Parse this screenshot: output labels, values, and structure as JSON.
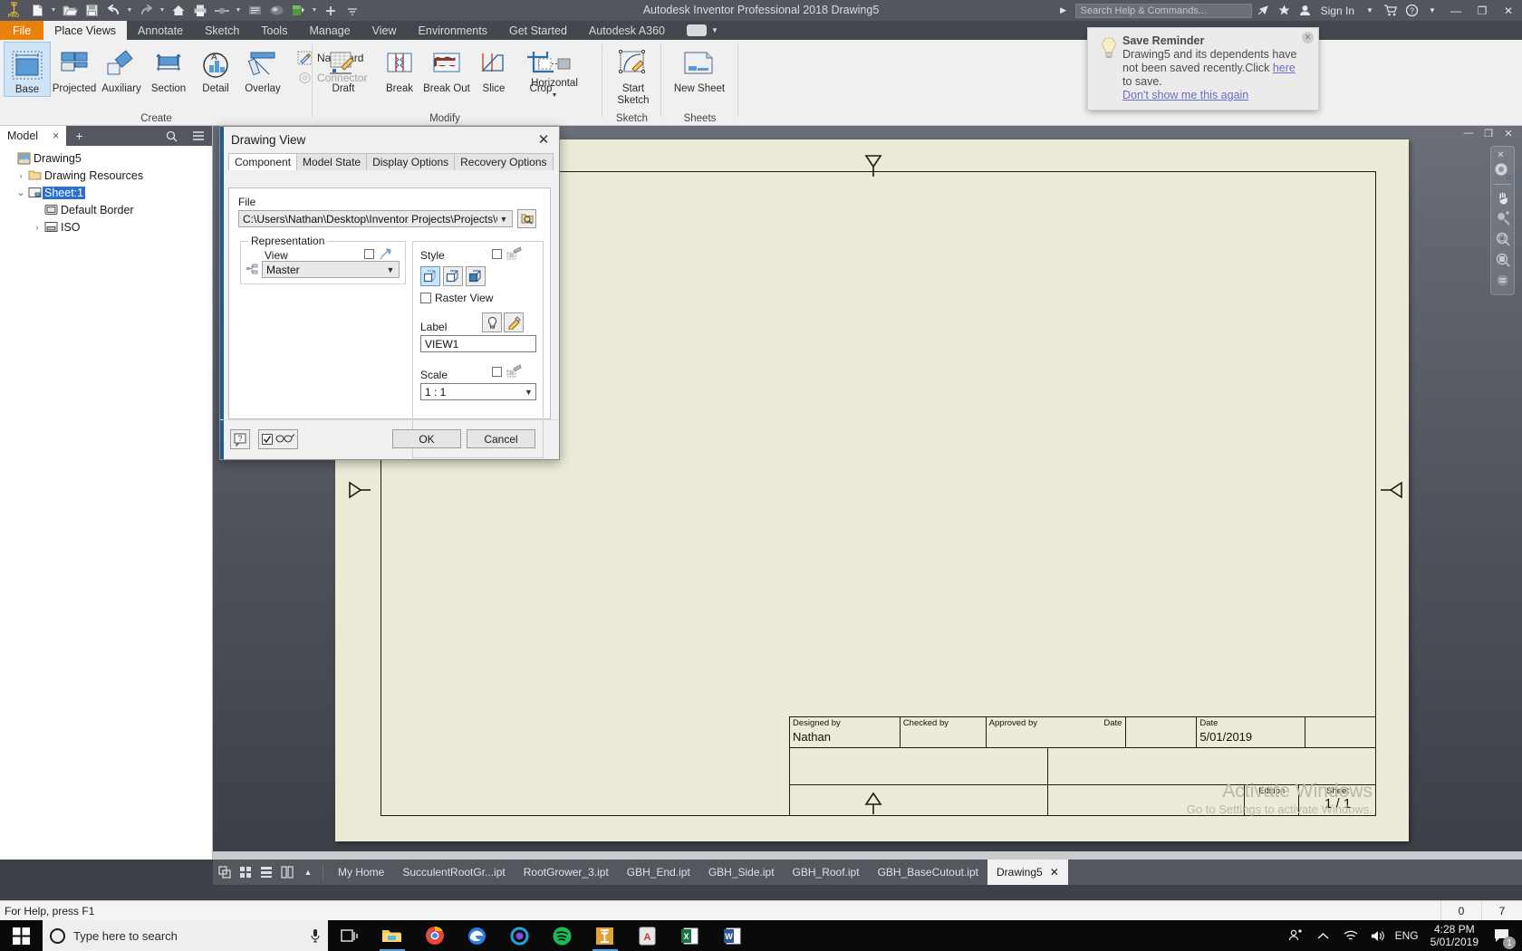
{
  "titlebar": {
    "app_title": "Autodesk Inventor Professional 2018   Drawing5",
    "search_placeholder": "Search Help & Commands...",
    "signin": "Sign In",
    "qat_icons": [
      "inventor-pro-logo",
      "new-icon",
      "open-icon",
      "save-icon",
      "undo-icon",
      "redo-icon",
      "home-icon",
      "print-icon",
      "select-icon",
      "parameters-icon",
      "materials-icon",
      "appearance-icon",
      "add-icon",
      "qat-dropdown-icon"
    ],
    "window_buttons": [
      "minimize",
      "restore",
      "close"
    ]
  },
  "ribbon": {
    "tabs": [
      {
        "label": "File",
        "kind": "file"
      },
      {
        "label": "Place Views",
        "kind": "active"
      },
      {
        "label": "Annotate",
        "kind": "normal"
      },
      {
        "label": "Sketch",
        "kind": "normal"
      },
      {
        "label": "Tools",
        "kind": "normal"
      },
      {
        "label": "Manage",
        "kind": "normal"
      },
      {
        "label": "View",
        "kind": "normal"
      },
      {
        "label": "Environments",
        "kind": "normal"
      },
      {
        "label": "Get Started",
        "kind": "normal"
      },
      {
        "label": "Autodesk A360",
        "kind": "normal"
      }
    ],
    "panels": [
      {
        "name": "Create",
        "label": "Create",
        "big_buttons": [
          {
            "label": "Base",
            "selected": true
          },
          {
            "label": "Projected",
            "selected": false
          },
          {
            "label": "Auxiliary",
            "selected": false
          },
          {
            "label": "Section",
            "selected": false
          },
          {
            "label": "Detail",
            "selected": false
          },
          {
            "label": "Overlay",
            "selected": false
          }
        ],
        "small_buttons": [
          {
            "label": "Nailboard",
            "disabled": false
          },
          {
            "label": "Connector",
            "disabled": true
          }
        ]
      },
      {
        "name": "Modify",
        "label": "Modify",
        "big_buttons": [
          {
            "label": "Draft",
            "selected": false
          },
          {
            "label": "Break",
            "selected": false
          },
          {
            "label": "Break Out",
            "selected": false
          },
          {
            "label": "Slice",
            "selected": false
          },
          {
            "label": "Crop",
            "selected": false
          },
          {
            "label": "Horizontal",
            "selected": false
          }
        ]
      },
      {
        "name": "Sketch",
        "label": "Sketch",
        "big_buttons": [
          {
            "label": "Start\nSketch",
            "selected": false
          }
        ]
      },
      {
        "name": "Sheets",
        "label": "Sheets",
        "big_buttons": [
          {
            "label": "New Sheet",
            "selected": false
          }
        ]
      }
    ]
  },
  "reminder": {
    "title": "Save Reminder",
    "line1": "Drawing5 and its dependents have",
    "line2": "not been saved recently.Click",
    "link_here": "here",
    "line3": "to save.",
    "dont_show": "Don't show me this again"
  },
  "browser": {
    "tab_label": "Model",
    "close_label": "×",
    "add_label": "+",
    "tree": [
      {
        "label": "Drawing5",
        "icon": "drawing-icon",
        "depth": 0,
        "expander": "",
        "selected": false
      },
      {
        "label": "Drawing Resources",
        "icon": "folder-icon",
        "depth": 1,
        "expander": "›",
        "selected": false
      },
      {
        "label": "Sheet:1",
        "icon": "sheet-icon",
        "depth": 1,
        "expander": "⌄",
        "selected": true
      },
      {
        "label": "Default Border",
        "icon": "border-icon",
        "depth": 2,
        "expander": "",
        "selected": false
      },
      {
        "label": "ISO",
        "icon": "titleblock-icon",
        "depth": 2,
        "expander": "›",
        "selected": false
      }
    ]
  },
  "dialog": {
    "title": "Drawing View",
    "close_label": "✕",
    "tabs": [
      {
        "label": "Component",
        "active": true
      },
      {
        "label": "Model State",
        "active": false
      },
      {
        "label": "Display Options",
        "active": false
      },
      {
        "label": "Recovery Options",
        "active": false
      }
    ],
    "file_label": "File",
    "file_value": "C:\\Users\\Nathan\\Desktop\\Inventor Projects\\Projects\\GBH\\G",
    "representation_label": "Representation",
    "view_label": "View",
    "view_value": "Master",
    "style_label": "Style",
    "style_buttons": [
      "hidden-line-icon",
      "hidden-line-removed-icon",
      "shaded-icon"
    ],
    "style_selected_index": 0,
    "raster_view_label": "Raster View",
    "raster_view_checked": false,
    "label_label": "Label",
    "label_value": "VIEW1",
    "scale_label": "Scale",
    "scale_value": "1 : 1",
    "ok_label": "OK",
    "cancel_label": "Cancel",
    "help_label": "?",
    "checkbox_checked": true
  },
  "titleblock": {
    "designed_by_caption": "Designed by",
    "designed_by_value": "Nathan",
    "checked_by_caption": "Checked by",
    "approved_by_caption": "Approved by",
    "date_caption_1": "Date",
    "date_caption_2": "Date",
    "date_value": "5/01/2019",
    "edition_caption": "Edition",
    "sheet_caption": "Sheet",
    "sheet_value": "1 / 1"
  },
  "watermark": {
    "line1": "Activate Windows",
    "line2": "Go to Settings to activate Windows."
  },
  "doc_tabs": {
    "view_icons": [
      "tile-icon",
      "grid-icon",
      "list-icon",
      "columns-icon",
      "collapse-icon"
    ],
    "items": [
      {
        "label": "My Home",
        "active": false,
        "closable": false
      },
      {
        "label": "SucculentRootGr...ipt",
        "active": false,
        "closable": false
      },
      {
        "label": "RootGrower_3.ipt",
        "active": false,
        "closable": false
      },
      {
        "label": "GBH_End.ipt",
        "active": false,
        "closable": false
      },
      {
        "label": "GBH_Side.ipt",
        "active": false,
        "closable": false
      },
      {
        "label": "GBH_Roof.ipt",
        "active": false,
        "closable": false
      },
      {
        "label": "GBH_BaseCutout.ipt",
        "active": false,
        "closable": false
      },
      {
        "label": "Drawing5",
        "active": true,
        "closable": true
      }
    ]
  },
  "statusbar": {
    "help_text": "For Help, press F1",
    "cell_1": "0",
    "cell_2": "7"
  },
  "taskbar": {
    "search_placeholder": "Type here to search",
    "icons": [
      "task-view-icon",
      "file-explorer-icon",
      "chrome-icon",
      "edge-icon",
      "cortana-icon",
      "spotify-icon",
      "inventor-icon",
      "acrobat-icon",
      "excel-icon",
      "word-icon"
    ],
    "tray": [
      "people-icon",
      "chevron-up-icon",
      "wifi-icon",
      "volume-icon"
    ],
    "language": "ENG",
    "time": "4:28 PM",
    "date": "5/01/2019",
    "notification_count": "1"
  },
  "navbar": {
    "icons": [
      "close-icon",
      "full-nav-wheel-2d-icon",
      "pan-icon",
      "zoom-icon",
      "zoom-window-icon",
      "zoom-all-icon",
      "navbar-options-icon"
    ]
  },
  "colors": {
    "orange_accent": "#e8820c",
    "ribbon_bg": "#f0f0f0",
    "dark_chrome": "#53565c",
    "sheet_paper": "#ecebd8",
    "selection_blue": "#2a6fc9"
  }
}
